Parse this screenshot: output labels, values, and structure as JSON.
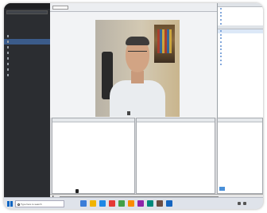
{
  "sidebar": {
    "title": "",
    "items": [
      "",
      ""
    ],
    "rows": [
      {
        "label": "",
        "active": false
      },
      {
        "label": "",
        "active": true
      },
      {
        "label": "",
        "active": false
      },
      {
        "label": "",
        "active": false
      },
      {
        "label": "",
        "active": false
      },
      {
        "label": "",
        "active": false
      },
      {
        "label": "",
        "active": false
      },
      {
        "label": "",
        "active": false
      }
    ]
  },
  "video": {
    "name_tag": ""
  },
  "panels": {
    "notes_title": "",
    "chat_title": "",
    "qa_title": "",
    "qa_message": "",
    "right_header_1": "",
    "right_header_2": ""
  },
  "taskbar": {
    "search_placeholder": "Type here to search",
    "icon_colors": [
      "#3b7dd8",
      "#f0b400",
      "#1e88e5",
      "#e53935",
      "#43a047",
      "#fb8c00",
      "#8e24aa",
      "#00897b",
      "#6d4c41",
      "#1565c0"
    ]
  },
  "colors": {
    "sidebar_bg": "#2b2d31",
    "accent": "#3b5b8a"
  }
}
